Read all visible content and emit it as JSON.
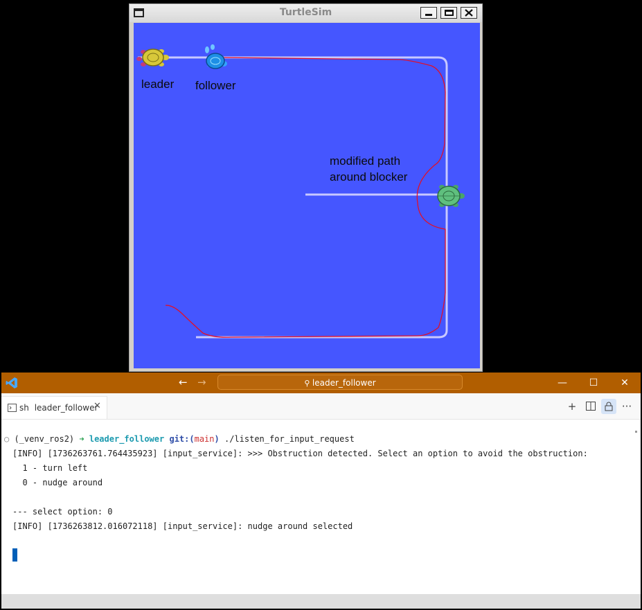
{
  "turtlesim": {
    "title": "TurtleSim",
    "labels": {
      "leader": "leader",
      "follower": "follower",
      "annotation_line1": "modified path",
      "annotation_line2": "around blocker"
    },
    "colors": {
      "background": "#4556ff",
      "trail": "#c8c8ff",
      "planned_path": "#e0102a"
    }
  },
  "vscode": {
    "search_text": "leader_follower",
    "tab": {
      "shell": "sh",
      "name": "leader_follower"
    },
    "accent_color": "#b15e00",
    "terminal": {
      "prompt": {
        "env": "(_venv_ros2)",
        "arrow": "➜",
        "dir": "leader_follower",
        "git_prefix": "git:(",
        "branch": "main",
        "git_suffix": ")",
        "command": "./listen_for_input_request"
      },
      "lines": [
        "[INFO] [1736263761.764435923] [input_service]: >>> Obstruction detected. Select an option to avoid the obstruction:",
        "  1 - turn left",
        "  0 - nudge around",
        "",
        "--- select option: 0",
        "[INFO] [1736263812.016072118] [input_service]: nudge around selected"
      ]
    }
  }
}
